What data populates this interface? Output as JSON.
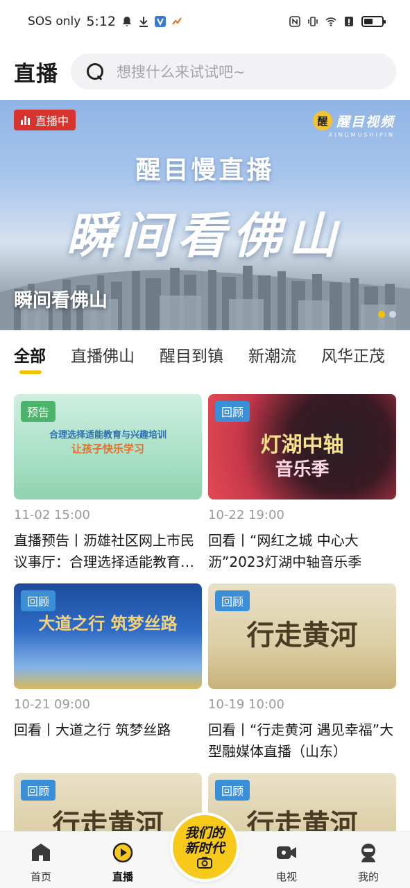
{
  "status_bar": {
    "carrier": "SOS only",
    "time": "5:12",
    "battery_level": 0.55
  },
  "header": {
    "title": "直播",
    "search_placeholder": "想搜什么来试试吧~"
  },
  "banner": {
    "live_badge": "直播中",
    "brand_name": "醒目视频",
    "brand_logo_char": "醒",
    "brand_sub": "XINGMUSHIPIN",
    "subtitle": "醒目慢直播",
    "headline": "瞬间看佛山",
    "caption": "瞬间看佛山",
    "dots_total": 2,
    "dots_active": 1,
    "colors": {
      "live_red": "#d8342f",
      "dot_active": "#f5c400",
      "dot_inactive": "#cfd6df"
    }
  },
  "tabs": [
    {
      "label": "全部",
      "active": true
    },
    {
      "label": "直播佛山",
      "active": false
    },
    {
      "label": "醒目到镇",
      "active": false
    },
    {
      "label": "新潮流",
      "active": false
    },
    {
      "label": "风华正茂",
      "active": false
    }
  ],
  "cards": [
    {
      "tag": "预告",
      "tag_color": "#4bb36a",
      "thumb_title": "合理选择适能教育与兴趣培训",
      "thumb_sub": "让孩子快乐学习",
      "time": "11-02 15:00",
      "title": "直播预告丨沥雄社区网上市民议事厅：合理选择适能教育与兴趣培训"
    },
    {
      "tag": "回顾",
      "tag_color": "#3a8fd6",
      "thumb_title": "灯湖中轴",
      "thumb_sub": "音乐季",
      "time": "10-22 19:00",
      "title": "回看丨“网红之城 中心大沥”2023灯湖中轴音乐季"
    },
    {
      "tag": "回顾",
      "tag_color": "#3a8fd6",
      "thumb_title": "大道之行 筑梦丝路",
      "thumb_sub": "",
      "time": "10-21 09:00",
      "title": "回看丨大道之行 筑梦丝路"
    },
    {
      "tag": "回顾",
      "tag_color": "#3a8fd6",
      "thumb_title": "行走黄河",
      "thumb_sub": "",
      "time": "10-19 10:00",
      "title": "回看丨“行走黄河 遇见幸福”大型融媒体直播（山东）"
    },
    {
      "tag": "回顾",
      "tag_color": "#3a8fd6",
      "thumb_title": "行走黄河",
      "thumb_sub": "",
      "time": "",
      "title": ""
    },
    {
      "tag": "回顾",
      "tag_color": "#3a8fd6",
      "thumb_title": "行走黄河",
      "thumb_sub": "",
      "time": "",
      "title": ""
    }
  ],
  "bottom_nav": {
    "items": [
      {
        "label": "首页",
        "icon": "home-icon",
        "active": false
      },
      {
        "label": "直播",
        "icon": "live-play-icon",
        "active": true
      },
      {
        "label": "电视",
        "icon": "tv-camera-icon",
        "active": false
      },
      {
        "label": "我的",
        "icon": "profile-icon",
        "active": false
      }
    ],
    "center_line1": "我们的",
    "center_line2": "新时代",
    "center_icon": "camera-icon",
    "accent": "#f6c91a"
  }
}
